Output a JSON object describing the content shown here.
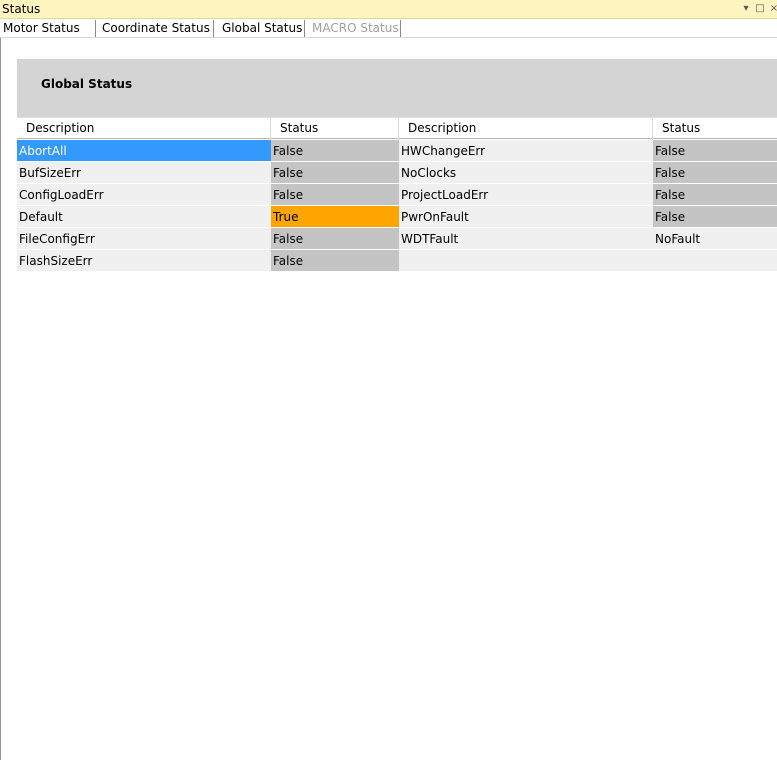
{
  "window": {
    "title": "Status",
    "controls": [
      "▾",
      "□",
      "×"
    ]
  },
  "tabs": [
    {
      "label": "Motor Status",
      "enabled": true
    },
    {
      "label": "Coordinate Status",
      "enabled": true
    },
    {
      "label": "Global Status",
      "enabled": true,
      "selected": true
    },
    {
      "label": "MACRO Status",
      "enabled": false
    }
  ],
  "group": {
    "title": "Global Status"
  },
  "grid": {
    "columns": [
      "Description",
      "Status",
      "Description",
      "Status"
    ],
    "rows": [
      {
        "d1": "AbortAll",
        "s1": "False",
        "d2": "HWChangeErr",
        "s2": "False"
      },
      {
        "d1": "BufSizeErr",
        "s1": "False",
        "d2": "NoClocks",
        "s2": "False"
      },
      {
        "d1": "ConfigLoadErr",
        "s1": "False",
        "d2": "ProjectLoadErr",
        "s2": "False"
      },
      {
        "d1": "Default",
        "s1": "True",
        "d2": "PwrOnFault",
        "s2": "False"
      },
      {
        "d1": "FileConfigErr",
        "s1": "False",
        "d2": "WDTFault",
        "s2": "NoFault"
      },
      {
        "d1": "FlashSizeErr",
        "s1": "False",
        "d2": "",
        "s2": ""
      }
    ]
  },
  "colors": {
    "title_bar": "#fdf4bf",
    "selected_row": "#3399ff",
    "true_status": "#ffa500",
    "status_cell": "#c4c4c4",
    "header_band": "#d4d4d4"
  }
}
